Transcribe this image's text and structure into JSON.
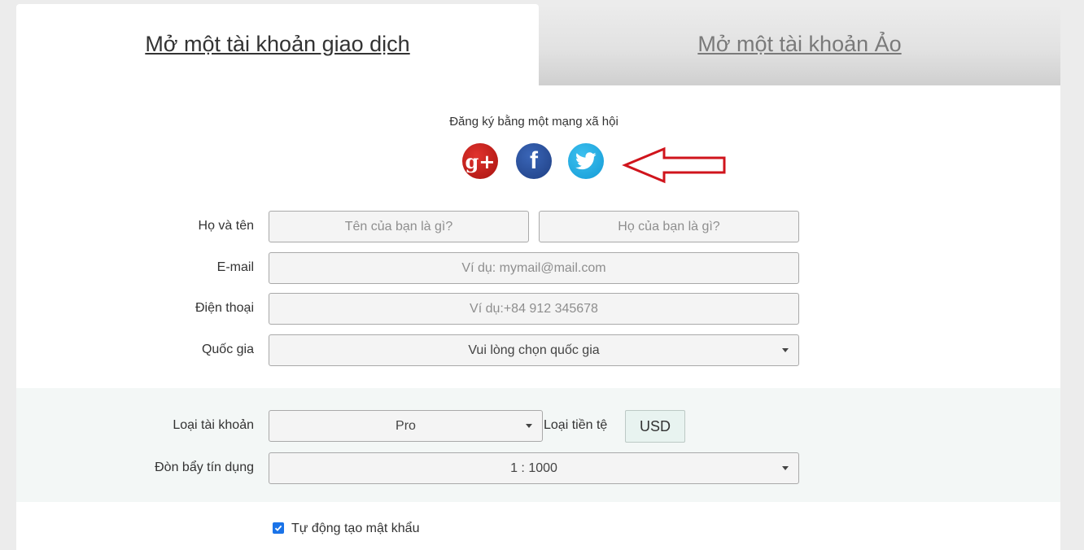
{
  "tabs": [
    {
      "label": "Mở một tài khoản giao dịch",
      "active": true
    },
    {
      "label": "Mở một tài khoản Ảo",
      "active": false
    }
  ],
  "social": {
    "label": "Đăng ký bằng một mạng xã hội",
    "networks": [
      "google-plus",
      "facebook",
      "twitter"
    ],
    "gplus_glyph": "g+",
    "fb_glyph": "f"
  },
  "form": {
    "name_label": "Họ và tên",
    "first_name_placeholder": "Tên của bạn là gì?",
    "last_name_placeholder": "Họ của bạn là gì?",
    "email_label": "E-mail",
    "email_placeholder": "Ví dụ: mymail@mail.com",
    "phone_label": "Điện thoại",
    "phone_placeholder": "Ví dụ:+84 912 345678",
    "country_label": "Quốc gia",
    "country_value": "Vui lòng chọn quốc gia"
  },
  "account": {
    "type_label": "Loại tài khoản",
    "type_value": "Pro",
    "currency_label": "Loại tiền tệ",
    "currency_value": "USD",
    "leverage_label": "Đòn bẩy tín dụng",
    "leverage_value": "1 : 1000"
  },
  "password": {
    "auto_label": "Tự động tạo mật khẩu",
    "checked": true
  },
  "colors": {
    "checkbox": "#1a73e8",
    "arrow": "#d0141c",
    "band": "#f3f7f6"
  }
}
